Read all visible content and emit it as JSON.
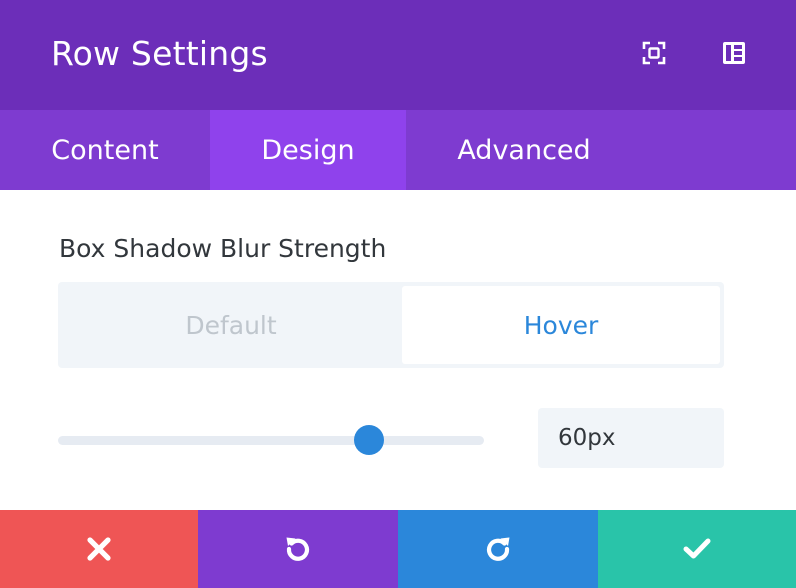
{
  "header": {
    "title": "Row Settings",
    "icons": [
      "fullscreen-icon",
      "sidebar-layout-icon"
    ]
  },
  "tabs": [
    {
      "label": "Content",
      "active": false
    },
    {
      "label": "Design",
      "active": true
    },
    {
      "label": "Advanced",
      "active": false
    }
  ],
  "field": {
    "label": "Box Shadow Blur Strength",
    "states": [
      "Default",
      "Hover"
    ],
    "active_state": "Hover",
    "value": "60px",
    "slider_fraction": 0.73
  },
  "footer": {
    "buttons": [
      "close-icon",
      "undo-icon",
      "redo-icon",
      "check-icon"
    ]
  },
  "colors": {
    "header_bg": "#6c2eb9",
    "tabs_bg": "#7e3bd0",
    "active_tab_bg": "#8f42ec",
    "accent_blue": "#2b87da",
    "cancel_red": "#ef5555",
    "save_green": "#29c4a9"
  }
}
